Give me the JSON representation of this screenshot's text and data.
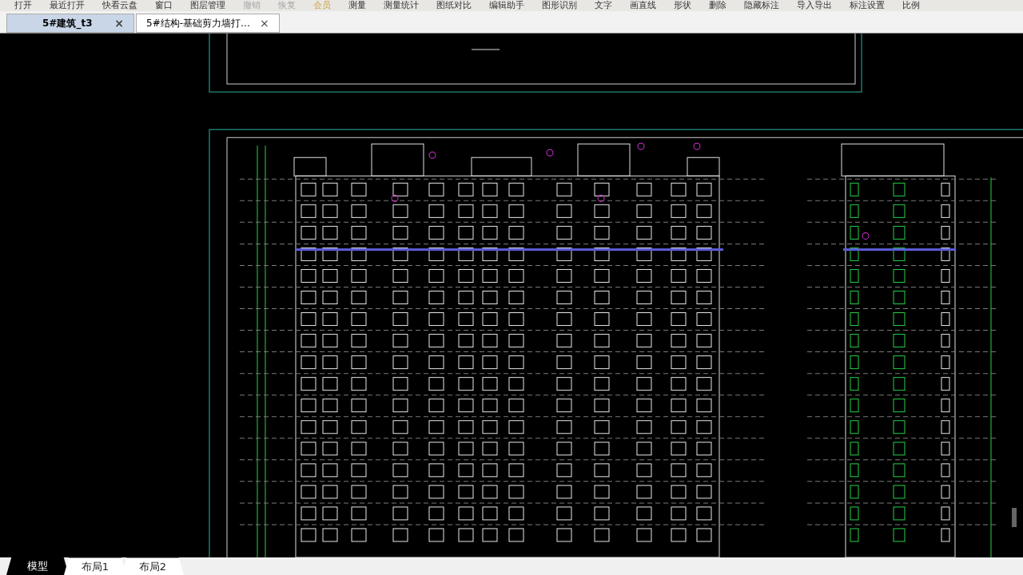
{
  "menu": [
    {
      "label": "打开",
      "disabled": false,
      "kind": "normal"
    },
    {
      "label": "最近打开",
      "disabled": false,
      "kind": "normal"
    },
    {
      "label": "快看云盘",
      "disabled": false,
      "kind": "normal"
    },
    {
      "label": "窗口",
      "disabled": false,
      "kind": "normal"
    },
    {
      "label": "图层管理",
      "disabled": false,
      "kind": "normal"
    },
    {
      "label": "撤销",
      "disabled": true,
      "kind": "normal"
    },
    {
      "label": "恢复",
      "disabled": true,
      "kind": "normal"
    },
    {
      "label": "会员",
      "disabled": false,
      "kind": "vip"
    },
    {
      "label": "测量",
      "disabled": false,
      "kind": "normal"
    },
    {
      "label": "测量统计",
      "disabled": false,
      "kind": "normal"
    },
    {
      "label": "图纸对比",
      "disabled": false,
      "kind": "normal"
    },
    {
      "label": "编辑助手",
      "disabled": false,
      "kind": "normal"
    },
    {
      "label": "图形识别",
      "disabled": false,
      "kind": "normal"
    },
    {
      "label": "文字",
      "disabled": false,
      "kind": "normal"
    },
    {
      "label": "画直线",
      "disabled": false,
      "kind": "normal"
    },
    {
      "label": "形状",
      "disabled": false,
      "kind": "normal"
    },
    {
      "label": "删除",
      "disabled": false,
      "kind": "normal"
    },
    {
      "label": "隐藏标注",
      "disabled": false,
      "kind": "normal"
    },
    {
      "label": "导入导出",
      "disabled": false,
      "kind": "normal"
    },
    {
      "label": "标注设置",
      "disabled": false,
      "kind": "normal"
    },
    {
      "label": "比例",
      "disabled": false,
      "kind": "normal"
    }
  ],
  "file_tabs": [
    {
      "label": "5#建筑_t3",
      "close": "×",
      "selected": true
    },
    {
      "label": "5#结构-基础剪力墙打…",
      "close": "×",
      "selected": false
    }
  ],
  "layout_tabs": [
    {
      "label": "模型",
      "selected": true
    },
    {
      "label": "布局1",
      "selected": false
    },
    {
      "label": "布局2",
      "selected": false
    }
  ]
}
